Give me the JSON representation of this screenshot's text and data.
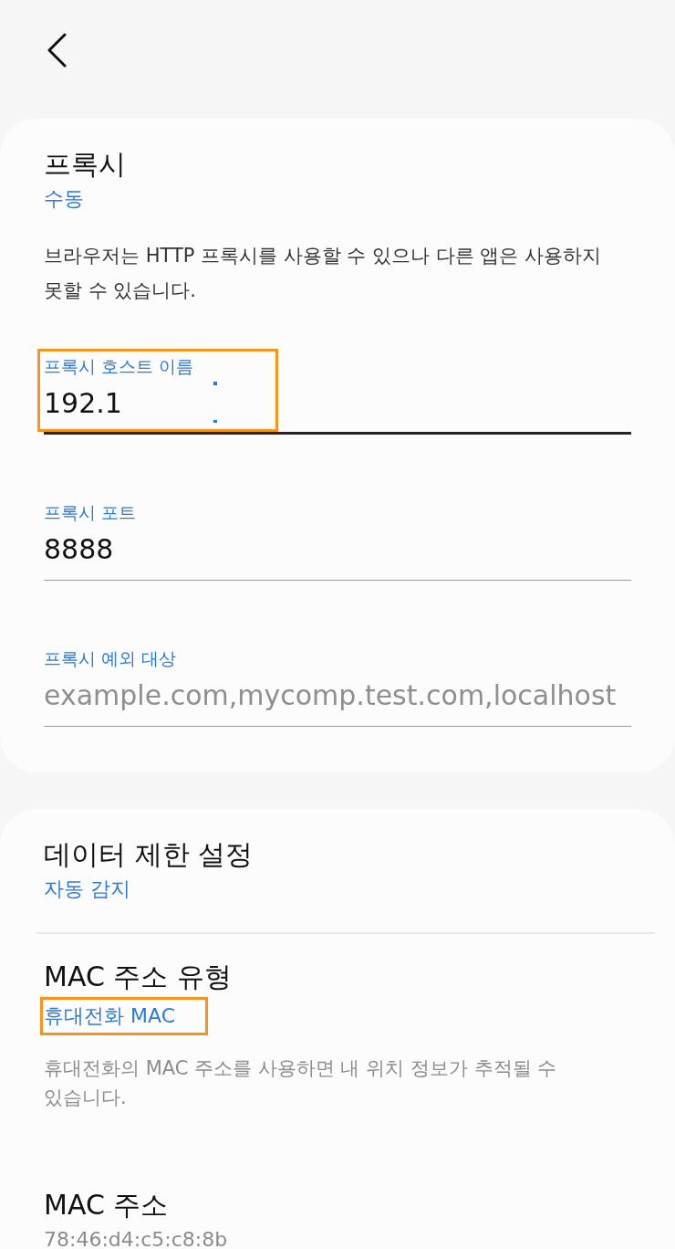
{
  "proxy": {
    "title": "프록시",
    "value": "수동",
    "note": "브라우저는 HTTP 프록시를 사용할 수 있으나 다른 앱은 사용하지 못할 수 있습니다.",
    "fields": [
      {
        "label": "프록시 호스트 이름",
        "value": "192.1",
        "focused": true,
        "highlighted": true
      },
      {
        "label": "프록시 포트",
        "value": "8888",
        "focused": false,
        "highlighted": false
      },
      {
        "label": "프록시 예외 대상",
        "placeholder": "example.com,mycomp.test.com,localhost",
        "focused": false,
        "highlighted": false
      }
    ]
  },
  "settings": [
    {
      "kind": "option",
      "title": "데이터 제한 설정",
      "value": "자동 감지",
      "highlighted": false,
      "divider": true
    },
    {
      "kind": "option",
      "title": "MAC 주소 유형",
      "value": "휴대전화 MAC",
      "highlighted": true,
      "divider": false,
      "note": "휴대전화의 MAC 주소를 사용하면 내 위치 정보가 추적될 수 있습니다."
    },
    {
      "kind": "info",
      "title": "MAC 주소",
      "value": "78:46:d4:c5:c8:8b",
      "highlighted": false,
      "divider": false
    }
  ]
}
